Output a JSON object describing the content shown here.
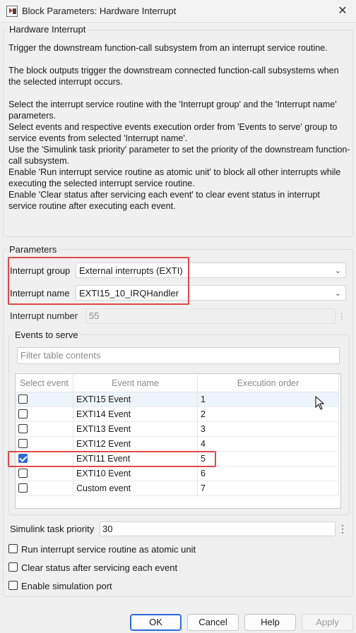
{
  "window": {
    "title": "Block Parameters: Hardware Interrupt",
    "close_glyph": "✕"
  },
  "description": {
    "legend": "Hardware Interrupt",
    "text": "Trigger the downstream function-call subsystem from an interrupt service routine.\n\nThe block outputs trigger the downstream connected function-call subsystems when the selected interrupt occurs.\n\nSelect the interrupt service routine with the 'Interrupt group' and the 'Interrupt name' parameters.\nSelect events and respective events execution order from 'Events to serve' group to service events from selected 'Interrupt name'.\nUse the 'Simulink task priority' parameter to set the priority of the downstream function-call subsystem.\nEnable 'Run interrupt service routine as atomic unit' to block all other interrupts while executing the selected interrupt service routine.\nEnable 'Clear status after servicing each event' to clear event status in interrupt service routine after executing each event."
  },
  "parameters": {
    "legend": "Parameters",
    "interrupt_group": {
      "label": "Interrupt group",
      "value": "External interrupts (EXTI)"
    },
    "interrupt_name": {
      "label": "Interrupt name",
      "value": "EXTI15_10_IRQHandler"
    },
    "interrupt_number": {
      "label": "Interrupt number",
      "value": "55"
    },
    "events": {
      "legend": "Events to serve",
      "filter_placeholder": "Filter table contents",
      "columns": [
        "Select event",
        "Event name",
        "Execution order"
      ],
      "rows": [
        {
          "checked": false,
          "name": "EXTI15 Event",
          "order": "1"
        },
        {
          "checked": false,
          "name": "EXTI14 Event",
          "order": "2"
        },
        {
          "checked": false,
          "name": "EXTI13 Event",
          "order": "3"
        },
        {
          "checked": false,
          "name": "EXTI12 Event",
          "order": "4"
        },
        {
          "checked": true,
          "name": "EXTI11 Event",
          "order": "5"
        },
        {
          "checked": false,
          "name": "EXTI10 Event",
          "order": "6"
        },
        {
          "checked": false,
          "name": "Custom event",
          "order": "7"
        }
      ]
    },
    "task_priority": {
      "label": "Simulink task priority",
      "value": "30"
    },
    "options": [
      {
        "label": "Run interrupt service routine as atomic unit",
        "checked": false
      },
      {
        "label": "Clear status after servicing each event",
        "checked": false
      },
      {
        "label": "Enable simulation port",
        "checked": false
      }
    ]
  },
  "buttons": {
    "ok": "OK",
    "cancel": "Cancel",
    "help": "Help",
    "apply": "Apply"
  }
}
